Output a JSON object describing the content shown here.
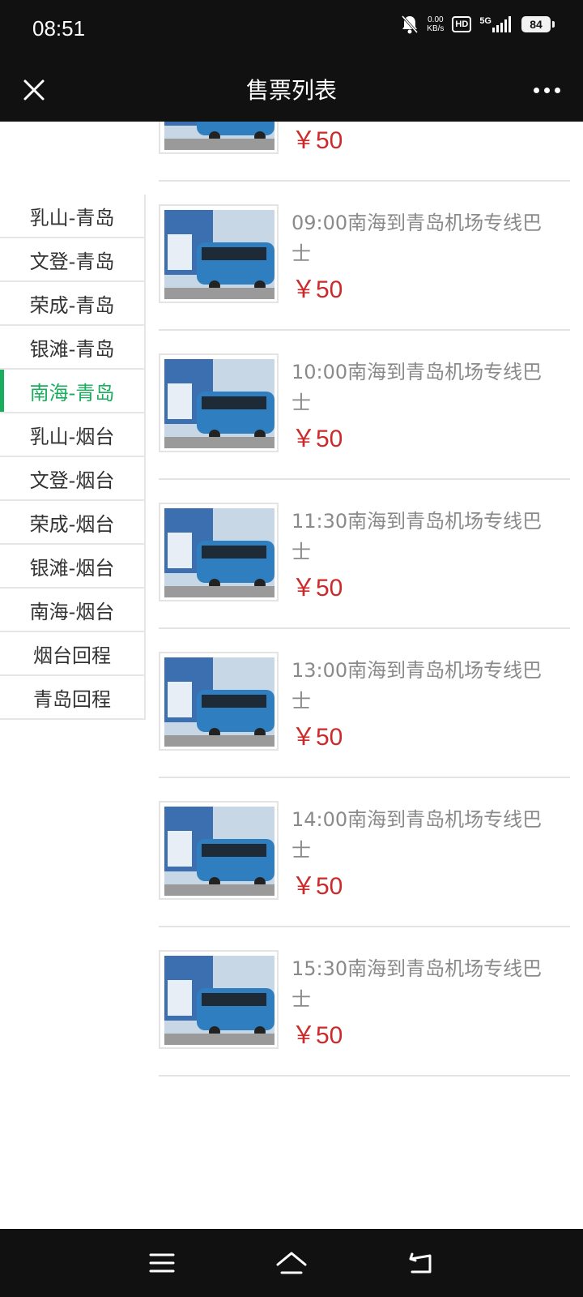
{
  "status": {
    "time": "08:51",
    "speed_value": "0.00",
    "speed_unit": "KB/s",
    "hd": "HD",
    "network": "5G",
    "battery": "84"
  },
  "nav": {
    "title": "售票列表"
  },
  "sidebar": {
    "items": [
      {
        "label": "乳山-青岛"
      },
      {
        "label": "文登-青岛"
      },
      {
        "label": "荣成-青岛"
      },
      {
        "label": "银滩-青岛"
      },
      {
        "label": "南海-青岛"
      },
      {
        "label": "乳山-烟台"
      },
      {
        "label": "文登-烟台"
      },
      {
        "label": "荣成-烟台"
      },
      {
        "label": "银滩-烟台"
      },
      {
        "label": "南海-烟台"
      },
      {
        "label": "烟台回程"
      },
      {
        "label": "青岛回程"
      }
    ],
    "active_index": 4,
    "active_color": "#1aad5e"
  },
  "tickets": [
    {
      "title": "",
      "price": "￥50"
    },
    {
      "title": "09:00南海到青岛机场专线巴士",
      "price": "￥50"
    },
    {
      "title": "10:00南海到青岛机场专线巴士",
      "price": "￥50"
    },
    {
      "title": "11:30南海到青岛机场专线巴士",
      "price": "￥50"
    },
    {
      "title": "13:00南海到青岛机场专线巴士",
      "price": "￥50"
    },
    {
      "title": "14:00南海到青岛机场专线巴士",
      "price": "￥50"
    },
    {
      "title": "15:30南海到青岛机场专线巴士",
      "price": "￥50"
    }
  ],
  "colors": {
    "price": "#cc2a2a",
    "bar_bg": "#111111"
  }
}
